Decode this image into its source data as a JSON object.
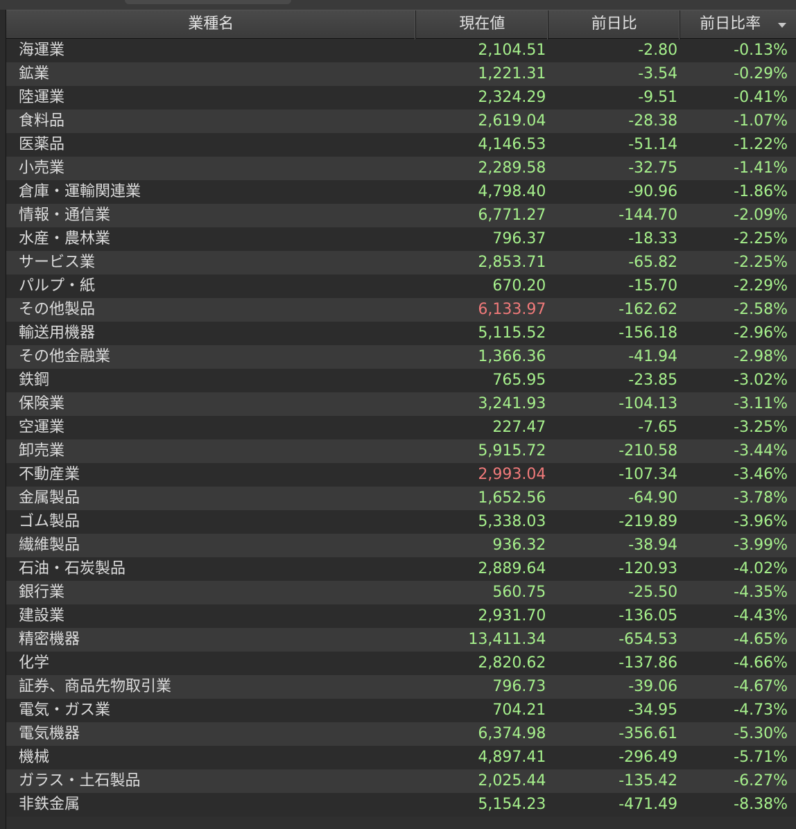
{
  "header": {
    "name": "業種名",
    "price": "現在値",
    "change": "前日比",
    "change_pct": "前日比率"
  },
  "rows": [
    {
      "name": "海運業",
      "price": "2,104.51",
      "change": "-2.80",
      "pct": "-0.13%",
      "price_color": "green"
    },
    {
      "name": "鉱業",
      "price": "1,221.31",
      "change": "-3.54",
      "pct": "-0.29%",
      "price_color": "green"
    },
    {
      "name": "陸運業",
      "price": "2,324.29",
      "change": "-9.51",
      "pct": "-0.41%",
      "price_color": "green"
    },
    {
      "name": "食料品",
      "price": "2,619.04",
      "change": "-28.38",
      "pct": "-1.07%",
      "price_color": "green"
    },
    {
      "name": "医薬品",
      "price": "4,146.53",
      "change": "-51.14",
      "pct": "-1.22%",
      "price_color": "green"
    },
    {
      "name": "小売業",
      "price": "2,289.58",
      "change": "-32.75",
      "pct": "-1.41%",
      "price_color": "green"
    },
    {
      "name": "倉庫・運輸関連業",
      "price": "4,798.40",
      "change": "-90.96",
      "pct": "-1.86%",
      "price_color": "green"
    },
    {
      "name": "情報・通信業",
      "price": "6,771.27",
      "change": "-144.70",
      "pct": "-2.09%",
      "price_color": "green"
    },
    {
      "name": "水産・農林業",
      "price": "796.37",
      "change": "-18.33",
      "pct": "-2.25%",
      "price_color": "green"
    },
    {
      "name": "サービス業",
      "price": "2,853.71",
      "change": "-65.82",
      "pct": "-2.25%",
      "price_color": "green"
    },
    {
      "name": "パルプ・紙",
      "price": "670.20",
      "change": "-15.70",
      "pct": "-2.29%",
      "price_color": "green"
    },
    {
      "name": "その他製品",
      "price": "6,133.97",
      "change": "-162.62",
      "pct": "-2.58%",
      "price_color": "red"
    },
    {
      "name": "輸送用機器",
      "price": "5,115.52",
      "change": "-156.18",
      "pct": "-2.96%",
      "price_color": "green"
    },
    {
      "name": "その他金融業",
      "price": "1,366.36",
      "change": "-41.94",
      "pct": "-2.98%",
      "price_color": "green"
    },
    {
      "name": "鉄鋼",
      "price": "765.95",
      "change": "-23.85",
      "pct": "-3.02%",
      "price_color": "green"
    },
    {
      "name": "保険業",
      "price": "3,241.93",
      "change": "-104.13",
      "pct": "-3.11%",
      "price_color": "green"
    },
    {
      "name": "空運業",
      "price": "227.47",
      "change": "-7.65",
      "pct": "-3.25%",
      "price_color": "green"
    },
    {
      "name": "卸売業",
      "price": "5,915.72",
      "change": "-210.58",
      "pct": "-3.44%",
      "price_color": "green"
    },
    {
      "name": "不動産業",
      "price": "2,993.04",
      "change": "-107.34",
      "pct": "-3.46%",
      "price_color": "red"
    },
    {
      "name": "金属製品",
      "price": "1,652.56",
      "change": "-64.90",
      "pct": "-3.78%",
      "price_color": "green"
    },
    {
      "name": "ゴム製品",
      "price": "5,338.03",
      "change": "-219.89",
      "pct": "-3.96%",
      "price_color": "green"
    },
    {
      "name": "繊維製品",
      "price": "936.32",
      "change": "-38.94",
      "pct": "-3.99%",
      "price_color": "green"
    },
    {
      "name": "石油・石炭製品",
      "price": "2,889.64",
      "change": "-120.93",
      "pct": "-4.02%",
      "price_color": "green"
    },
    {
      "name": "銀行業",
      "price": "560.75",
      "change": "-25.50",
      "pct": "-4.35%",
      "price_color": "green"
    },
    {
      "name": "建設業",
      "price": "2,931.70",
      "change": "-136.05",
      "pct": "-4.43%",
      "price_color": "green"
    },
    {
      "name": "精密機器",
      "price": "13,411.34",
      "change": "-654.53",
      "pct": "-4.65%",
      "price_color": "green"
    },
    {
      "name": "化学",
      "price": "2,820.62",
      "change": "-137.86",
      "pct": "-4.66%",
      "price_color": "green"
    },
    {
      "name": "証券、商品先物取引業",
      "price": "796.73",
      "change": "-39.06",
      "pct": "-4.67%",
      "price_color": "green"
    },
    {
      "name": "電気・ガス業",
      "price": "704.21",
      "change": "-34.95",
      "pct": "-4.73%",
      "price_color": "green"
    },
    {
      "name": "電気機器",
      "price": "6,374.98",
      "change": "-356.61",
      "pct": "-5.30%",
      "price_color": "green"
    },
    {
      "name": "機械",
      "price": "4,897.41",
      "change": "-296.49",
      "pct": "-5.71%",
      "price_color": "green"
    },
    {
      "name": "ガラス・土石製品",
      "price": "2,025.44",
      "change": "-135.42",
      "pct": "-6.27%",
      "price_color": "green"
    },
    {
      "name": "非鉄金属",
      "price": "5,154.23",
      "change": "-471.49",
      "pct": "-8.38%",
      "price_color": "green"
    }
  ],
  "colors": {
    "green": "#a6f08c",
    "red": "#f07a7a",
    "text": "#dcdcdc",
    "background": "#2b2b2b"
  },
  "icons": {
    "sort": "sort-descending-icon"
  }
}
